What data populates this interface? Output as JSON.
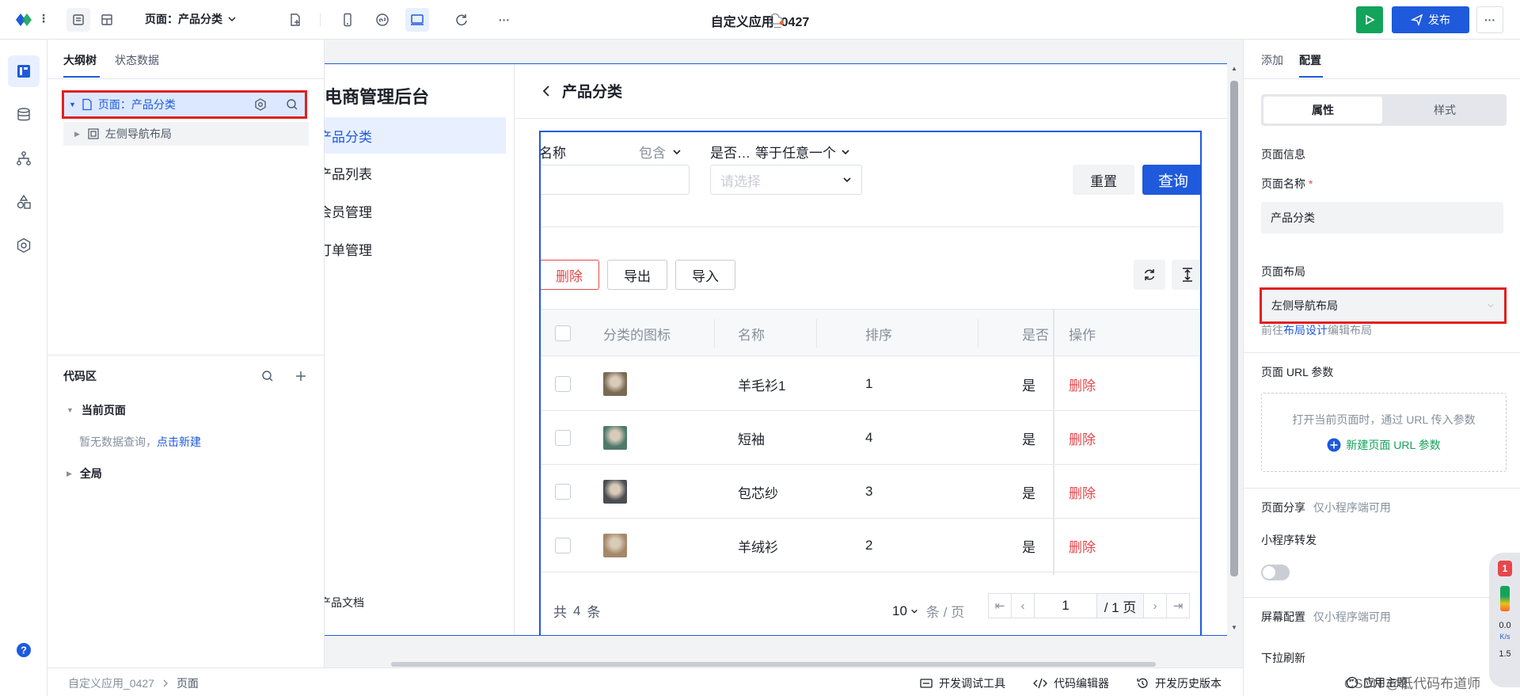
{
  "topbar": {
    "page_select": "页面：产品分类",
    "app_title": "自定义应用_0427",
    "publish_label": "发布",
    "more_label": "···"
  },
  "left_panel": {
    "tabs": [
      "大纲树",
      "状态数据"
    ],
    "tree": {
      "page_node": "页面：产品分类",
      "layout_node": "左侧导航布局"
    },
    "code_area": {
      "title": "代码区",
      "current_page": "当前页面",
      "empty_text": "暂无数据查询，",
      "create_link": "点击新建",
      "global": "全局"
    }
  },
  "preview": {
    "brand": "电商管理后台",
    "nav_items": [
      "产品分类",
      "产品列表",
      "会员管理",
      "订单管理"
    ],
    "doc_link": "产品文档",
    "page_title": "产品分类",
    "filter": {
      "name_label": "名称",
      "name_op": "包含",
      "flag_label": "是否…",
      "flag_op": "等于任意一个",
      "select_placeholder": "请选择",
      "reset": "重置",
      "query": "查询"
    },
    "toolbar": {
      "delete": "删除",
      "export": "导出",
      "import": "导入"
    },
    "table": {
      "columns": [
        "分类的图标",
        "名称",
        "排序",
        "是否",
        "操作"
      ],
      "rows": [
        {
          "name": "羊毛衫1",
          "order": "1",
          "flag": "是",
          "action": "删除",
          "color": "#7a6a55"
        },
        {
          "name": "短袖",
          "order": "4",
          "flag": "是",
          "action": "删除",
          "color": "#4f7a6a"
        },
        {
          "name": "包芯纱",
          "order": "3",
          "flag": "是",
          "action": "删除",
          "color": "#4a4d52"
        },
        {
          "name": "羊绒衫",
          "order": "2",
          "flag": "是",
          "action": "删除",
          "color": "#a5876a"
        }
      ]
    },
    "pagination": {
      "total_prefix": "共",
      "total": "4",
      "total_suffix": "条",
      "page_size": "10",
      "page_size_suffix": "条 / 页",
      "current_page": "1",
      "total_pages": "/ 1 页"
    }
  },
  "right_panel": {
    "tabs": [
      "添加",
      "配置"
    ],
    "segments": [
      "属性",
      "样式"
    ],
    "page_info": "页面信息",
    "page_name_label": "页面名称",
    "required_mark": "*",
    "page_name_value": "产品分类",
    "layout_label": "页面布局",
    "layout_value": "左侧导航布局",
    "layout_hint_pre": "前往",
    "layout_hint_link": "布局设计",
    "layout_hint_post": "编辑布局",
    "url_param_label": "页面 URL 参数",
    "url_param_hint": "打开当前页面时，通过 URL 传入参数",
    "url_param_add": "新建页面 URL 参数",
    "share_label": "页面分享",
    "share_hint": "仅小程序端可用",
    "mini_forward": "小程序转发",
    "screen_label": "屏幕配置",
    "screen_hint": "仅小程序端可用",
    "pull_refresh": "下拉刷新"
  },
  "footer": {
    "breadcrumb": [
      "自定义应用_0427",
      "页面"
    ],
    "dev_tools": "开发调试工具",
    "code_editor": "代码编辑器",
    "history": "开发历史版本",
    "theme": "应用主题",
    "watermark": "CSDN @低代码布道师"
  },
  "overlay": {
    "badge": "1",
    "net_value": "0.0",
    "net_unit": "K/s",
    "net_value2": "1.5"
  },
  "colors": {
    "accent": "#1e5adb",
    "danger": "#e5484d",
    "run": "#13a35b",
    "highlight_border": "#e02020"
  }
}
